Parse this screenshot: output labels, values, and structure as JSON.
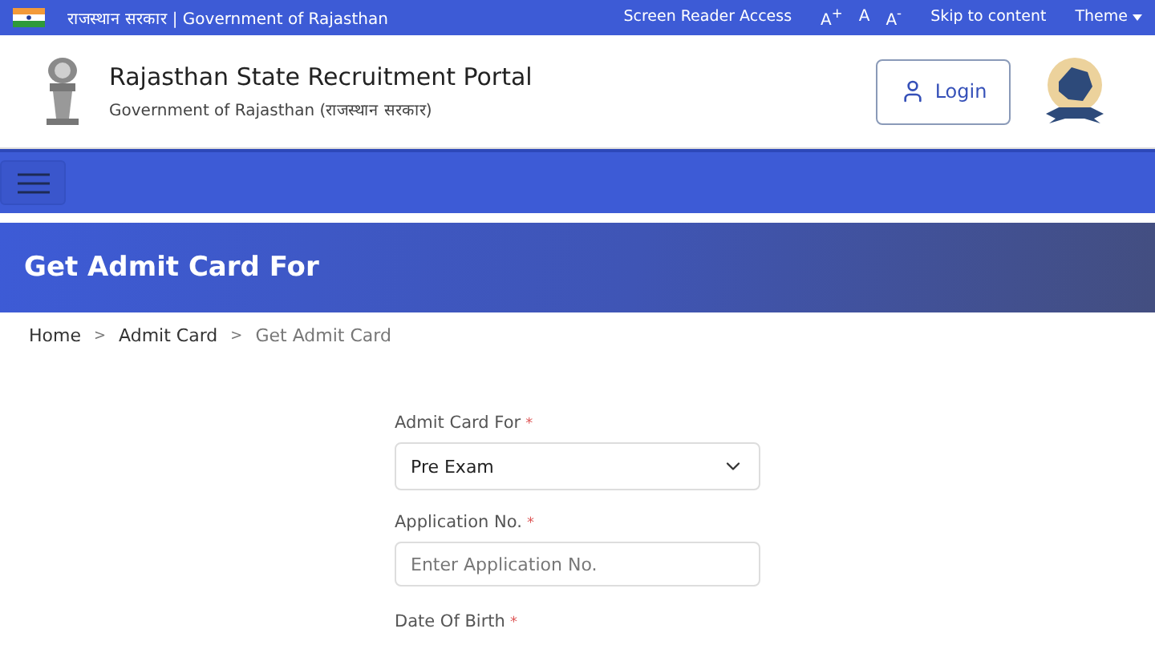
{
  "top_bar": {
    "govt_label": "राजस्थान सरकार | Government of Rajasthan",
    "links": [
      {
        "kind": "link",
        "label": "Screen Reader Access"
      },
      {
        "kind": "font",
        "label": "A$^{+}$"
      },
      {
        "kind": "font",
        "label": "A"
      },
      {
        "kind": "font",
        "label": "A$^{-}$"
      },
      {
        "kind": "link",
        "label": "Skip to content"
      },
      {
        "kind": "dropdown",
        "label": "Theme"
      }
    ]
  },
  "header": {
    "title": "Rajasthan State Recruitment Portal",
    "subtitle": "Government of Rajasthan (राजस्थान सरकार)",
    "login_button": "Login"
  },
  "page_banner": {
    "title": "Get Admit Card For"
  },
  "breadcrumb": [
    {
      "label": "Home",
      "current": false
    },
    {
      "label": "Admit Card",
      "current": false
    },
    {
      "label": "Get Admit Card",
      "current": true
    }
  ],
  "breadcrumb_separator": ">",
  "form": {
    "required_mark": "*",
    "fields": [
      {
        "kind": "select",
        "label": "Admit Card For",
        "value": "Pre Exam"
      },
      {
        "kind": "input",
        "label": "Application No.",
        "placeholder": "Enter Application No."
      },
      {
        "kind": "label_only",
        "label": "Date Of Birth"
      }
    ]
  }
}
